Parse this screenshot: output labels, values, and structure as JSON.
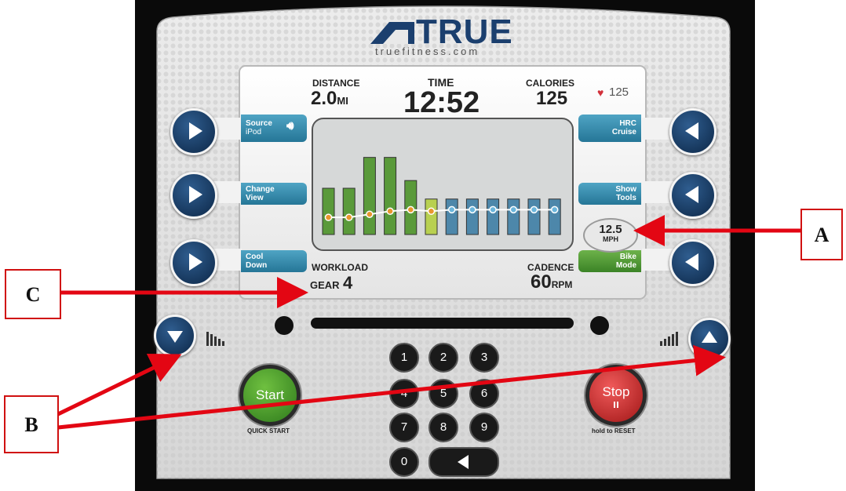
{
  "brand": {
    "logo_text": "TRUE",
    "url": "truefitness.com"
  },
  "stats": {
    "distance_label": "DISTANCE",
    "distance_value": "2.0",
    "distance_unit": "MI",
    "time_label": "TIME",
    "time_value": "12:52",
    "calories_label": "CALORIES",
    "calories_value": "125",
    "heart_rate": "125"
  },
  "left_buttons": [
    {
      "label_line1": "Source",
      "label_line2": "iPod",
      "icon": "speaker-icon"
    },
    {
      "label_line1": "Change",
      "label_line2": "View"
    },
    {
      "label_line1": "Cool",
      "label_line2": "Down"
    }
  ],
  "right_buttons": [
    {
      "label_line1": "HRC",
      "label_line2": "Cruise"
    },
    {
      "label_line1": "Show",
      "label_line2": "Tools"
    },
    {
      "label_line1": "Bike",
      "label_line2": "Mode"
    }
  ],
  "speed": {
    "value": "12.5",
    "unit": "MPH"
  },
  "workload": {
    "label": "WORKLOAD",
    "gear_label": "GEAR",
    "gear_value": "4"
  },
  "cadence": {
    "label": "CADENCE",
    "value": "60",
    "unit": "RPM"
  },
  "keypad": [
    "1",
    "2",
    "3",
    "4",
    "5",
    "6",
    "7",
    "8",
    "9",
    "0"
  ],
  "start": {
    "label": "Start",
    "sub": "QUICK START"
  },
  "stop": {
    "label": "Stop",
    "sub": "hold to RESET"
  },
  "callouts": {
    "a": "A",
    "b": "B",
    "c": "C"
  },
  "chart_data": {
    "type": "bar",
    "bars": [
      {
        "level": 3,
        "state": "completed"
      },
      {
        "level": 3,
        "state": "completed"
      },
      {
        "level": 5,
        "state": "completed"
      },
      {
        "level": 5,
        "state": "completed"
      },
      {
        "level": 3.5,
        "state": "completed"
      },
      {
        "level": 2.3,
        "state": "current"
      },
      {
        "level": 2.3,
        "state": "upcoming"
      },
      {
        "level": 2.3,
        "state": "upcoming"
      },
      {
        "level": 2.3,
        "state": "upcoming"
      },
      {
        "level": 2.3,
        "state": "upcoming"
      },
      {
        "level": 2.3,
        "state": "upcoming"
      },
      {
        "level": 2.3,
        "state": "upcoming"
      }
    ],
    "line": [
      0.5,
      0.5,
      0.7,
      0.9,
      1.0,
      0.9,
      1.0,
      1.0,
      1.0,
      1.0,
      1.0,
      1.0
    ],
    "ylim": [
      0,
      6
    ],
    "colors": {
      "completed": "#5a9a3a",
      "current": "#b8d050",
      "upcoming": "#4d87aa",
      "line_completed": "#e8962c",
      "line_upcoming": "#6cb6dc"
    }
  }
}
